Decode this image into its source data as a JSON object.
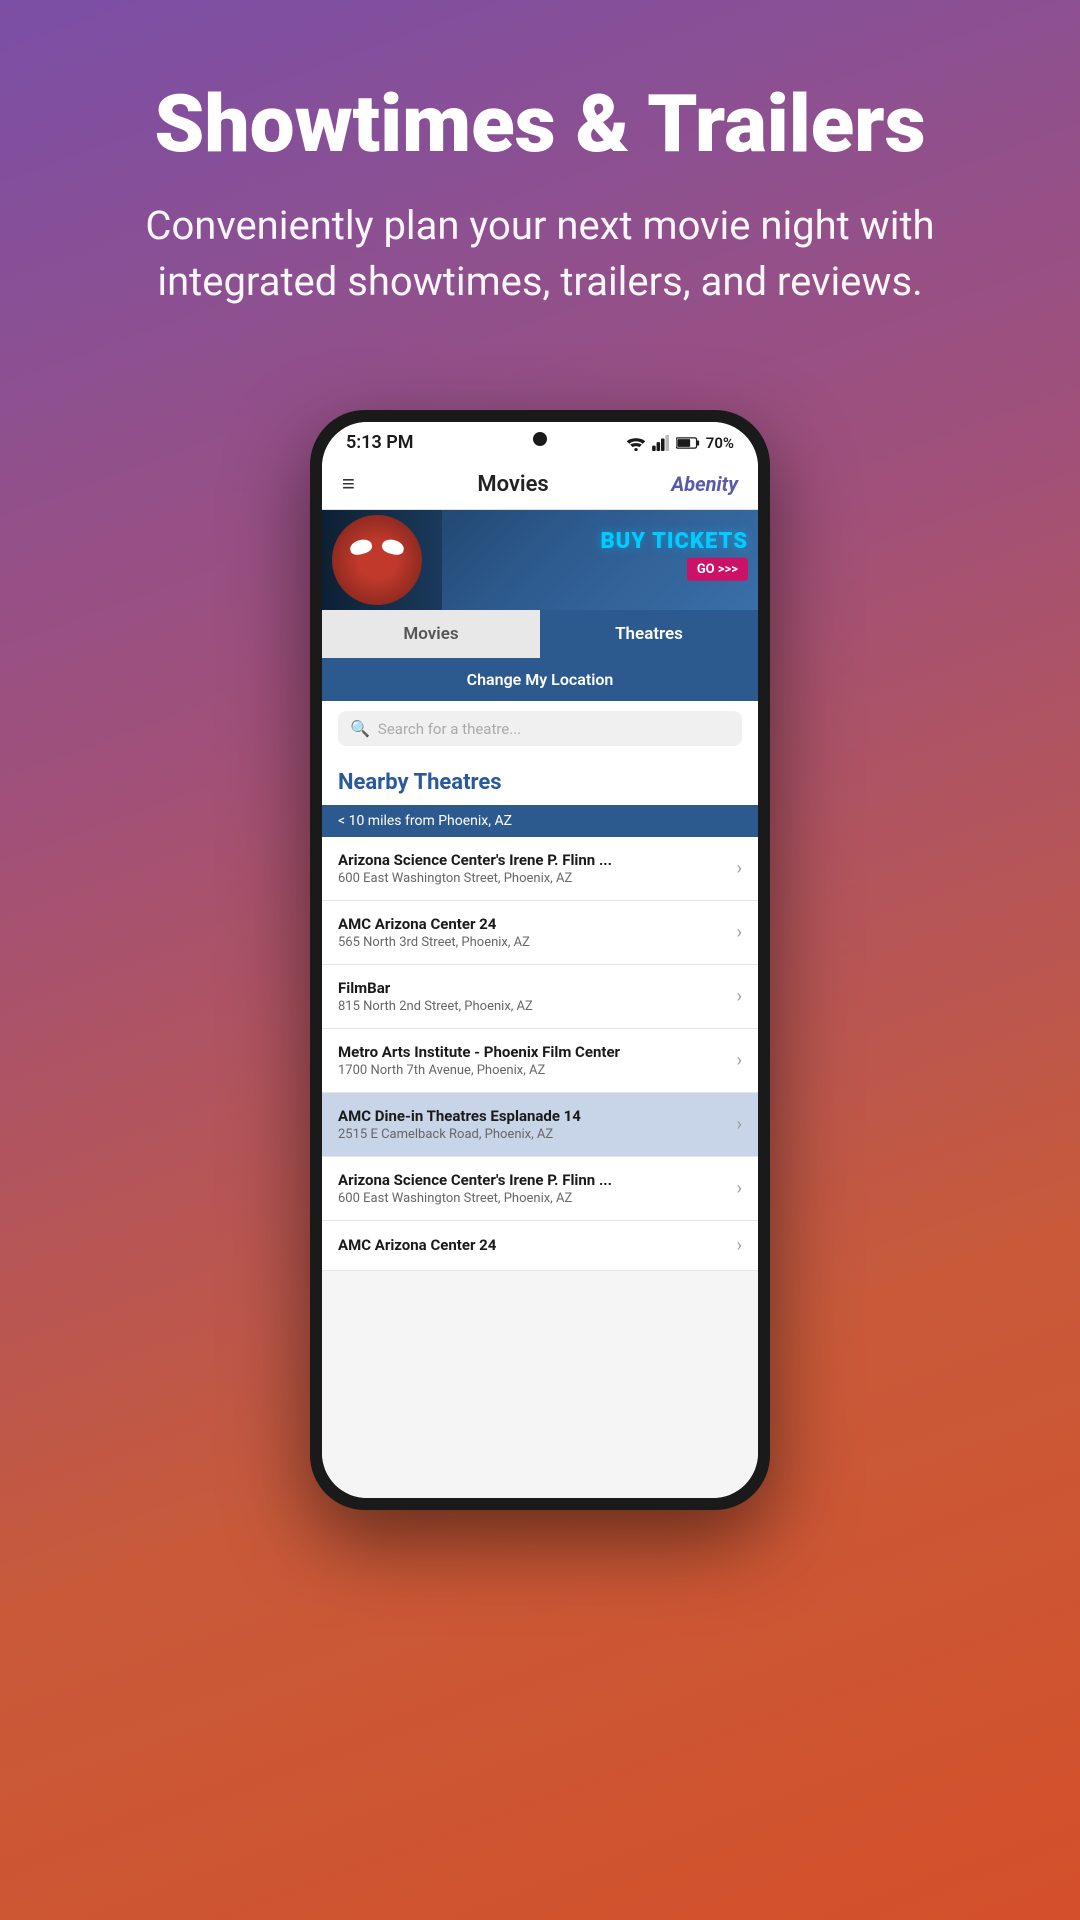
{
  "page": {
    "background": "gradient purple to orange",
    "headline": "Showtimes & Trailers",
    "subtitle": "Conveniently plan your next movie night with integrated showtimes, trailers, and reviews."
  },
  "status_bar": {
    "time": "5:13 PM",
    "battery": "70%",
    "wifi": "wifi",
    "signal": "signal"
  },
  "app_header": {
    "menu_icon": "≡",
    "title": "Movies",
    "logo": "Abenity"
  },
  "banner": {
    "buy_tickets": "BUY TICKETS",
    "go_label": "GO >>>"
  },
  "tabs": [
    {
      "label": "Movies",
      "active": false
    },
    {
      "label": "Theatres",
      "active": true
    }
  ],
  "location_bar": {
    "label": "Change My Location"
  },
  "search": {
    "placeholder": "Search for a theatre..."
  },
  "nearby_theatres": {
    "title": "Nearby Theatres",
    "distance_header": "< 10 miles from Phoenix, AZ",
    "items": [
      {
        "name": "Arizona Science Center's Irene P. Flinn ...",
        "address": "600 East Washington Street, Phoenix, AZ",
        "highlighted": false
      },
      {
        "name": "AMC Arizona Center 24",
        "address": "565 North 3rd Street, Phoenix, AZ",
        "highlighted": false
      },
      {
        "name": "FilmBar",
        "address": "815 North 2nd Street, Phoenix, AZ",
        "highlighted": false
      },
      {
        "name": "Metro Arts Institute - Phoenix Film Center",
        "address": "1700 North 7th Avenue, Phoenix, AZ",
        "highlighted": false
      },
      {
        "name": "AMC Dine-in Theatres Esplanade 14",
        "address": "2515 E Camelback Road, Phoenix, AZ",
        "highlighted": true
      },
      {
        "name": "Arizona Science Center's Irene P. Flinn ...",
        "address": "600 East Washington Street, Phoenix, AZ",
        "highlighted": false
      },
      {
        "name": "AMC Arizona Center 24",
        "address": "",
        "highlighted": false
      }
    ]
  }
}
